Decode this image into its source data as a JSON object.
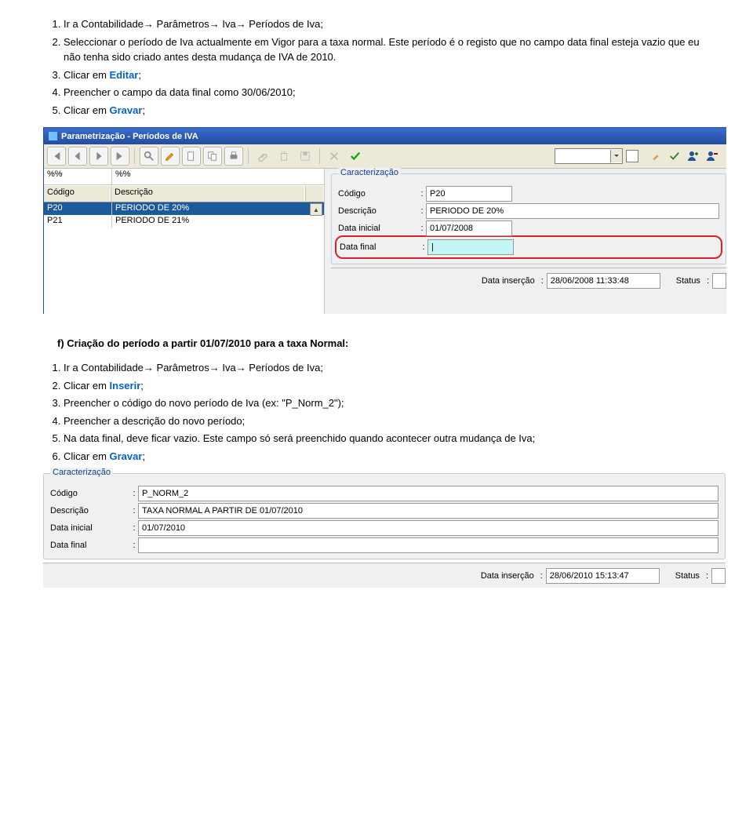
{
  "top_instructions": [
    {
      "text_prefix": "Ir a Contabilidade",
      "arrow1": "→",
      "text_mid1": " Parâmetros",
      "arrow2": "→",
      "text_mid2": " Iva",
      "arrow3": "→",
      "text_suffix": " Períodos de Iva;"
    },
    {
      "plain": "Seleccionar o período de Iva actualmente em Vigor para a taxa normal. Este período é o registo que no campo data final esteja vazio que eu não tenha sido criado antes desta mudança de IVA de 2010."
    },
    {
      "plain_prefix": "Clicar em ",
      "action": "Editar",
      "plain_suffix": ";"
    },
    {
      "plain": "Preencher o campo da data final como 30/06/2010;"
    },
    {
      "plain_prefix": "Clicar em ",
      "action": "Gravar",
      "plain_suffix": ";"
    }
  ],
  "section_f_title": "f)   Criação do período a partir 01/07/2010 para a taxa Normal:",
  "bottom_instructions": [
    {
      "text_prefix": "Ir a Contabilidade",
      "arrow1": "→",
      "text_mid1": " Parâmetros",
      "arrow2": "→",
      "text_mid2": " Iva",
      "arrow3": "→",
      "text_suffix": " Períodos de Iva;"
    },
    {
      "plain_prefix": "Clicar em ",
      "action": "Inserir",
      "plain_suffix": ";"
    },
    {
      "plain": "Preencher o código do novo período de Iva (ex: \"P_Norm_2\");"
    },
    {
      "plain": "Preencher a descrição do novo período;"
    },
    {
      "plain": "Na data final, deve ficar vazio. Este campo só será preenchido quando acontecer outra mudança de Iva;"
    },
    {
      "plain_prefix": "Clicar em ",
      "action": "Gravar",
      "plain_suffix": ";"
    }
  ],
  "window1": {
    "title": "Parametrização - Períodos de IVA",
    "filter1": "%%",
    "filter2": "%%",
    "col1": "Código",
    "col2": "Descrição",
    "rows": [
      {
        "c": "P20",
        "d": "PERIODO DE 20%"
      },
      {
        "c": "P21",
        "d": "PERIODO DE 21%"
      }
    ],
    "form": {
      "legend": "Caracterização",
      "lbl_codigo": "Código",
      "val_codigo": "P20",
      "lbl_descricao": "Descrição",
      "val_descricao": "PERIODO DE 20%",
      "lbl_data_inicial": "Data inicial",
      "val_data_inicial": "01/07/2008",
      "lbl_data_final": "Data final",
      "val_data_final": "|",
      "lbl_data_insercao": "Data inserção",
      "val_data_insercao": "28/06/2008 11:33:48",
      "lbl_status": "Status"
    }
  },
  "window2": {
    "legend": "Caracterização",
    "lbl_codigo": "Código",
    "val_codigo": "P_NORM_2",
    "lbl_descricao": "Descrição",
    "val_descricao": "TAXA NORMAL A PARTIR DE 01/07/2010",
    "lbl_data_inicial": "Data inicial",
    "val_data_inicial": "01/07/2010",
    "lbl_data_final": "Data final",
    "val_data_final": "",
    "lbl_data_insercao": "Data inserção",
    "val_data_insercao": "28/06/2010 15:13:47",
    "lbl_status": "Status"
  }
}
